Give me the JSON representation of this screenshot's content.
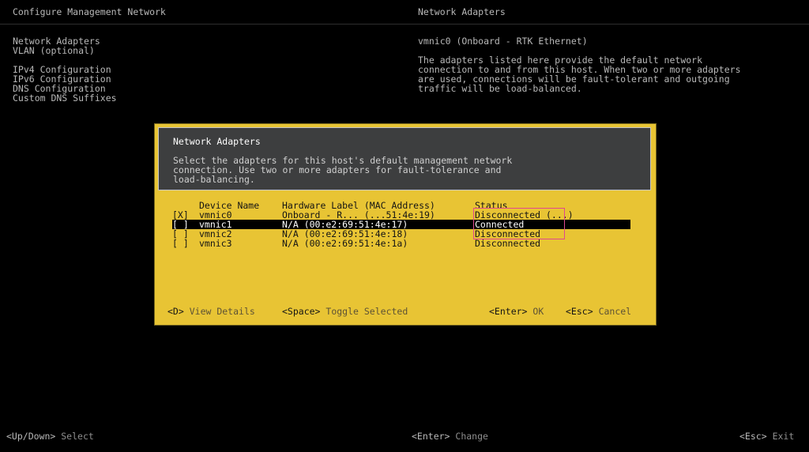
{
  "header": {
    "left_title": "Configure Management Network",
    "right_title": "Network Adapters"
  },
  "menu": {
    "items": [
      "Network Adapters",
      "VLAN (optional)",
      "IPv4 Configuration",
      "IPv6 Configuration",
      "DNS Configuration",
      "Custom DNS Suffixes"
    ]
  },
  "info": {
    "title": "vmnic0 (Onboard - RTK Ethernet)",
    "description": [
      "The adapters listed here provide the default network",
      "connection to and from this host. When two or more adapters",
      "are used, connections will be fault-tolerant and outgoing",
      "traffic will be load-balanced."
    ]
  },
  "dialog": {
    "title": "Network Adapters",
    "description": [
      "Select the adapters for this host's default management network",
      "connection. Use two or more adapters for fault-tolerance and",
      "load-balancing."
    ],
    "columns": {
      "name": "Device Name",
      "mac": "Hardware Label (MAC Address)",
      "status": "Status"
    },
    "rows": [
      {
        "sel": "[X]",
        "name": "vmnic0",
        "mac": "Onboard - R... (...51:4e:19)",
        "status": "Disconnected (...)"
      },
      {
        "sel": "[ ]",
        "name": "vmnic1",
        "mac": "N/A (00:e2:69:51:4e:17)",
        "status": "Connected"
      },
      {
        "sel": "[ ]",
        "name": "vmnic2",
        "mac": "N/A (00:e2:69:51:4e:18)",
        "status": "Disconnected"
      },
      {
        "sel": "[ ]",
        "name": "vmnic3",
        "mac": "N/A (00:e2:69:51:4e:1a)",
        "status": "Disconnected"
      }
    ],
    "selected_row": 1,
    "footer": {
      "details_key": "<D>",
      "details_label": "View Details",
      "toggle_key": "<Space>",
      "toggle_label": "Toggle Selected",
      "ok_key": "<Enter>",
      "ok_label": "OK",
      "cancel_key": "<Esc>",
      "cancel_label": "Cancel"
    }
  },
  "bottom_bar": {
    "select_key": "<Up/Down>",
    "select_label": "Select",
    "change_key": "<Enter>",
    "change_label": "Change",
    "exit_key": "<Esc>",
    "exit_label": "Exit"
  },
  "colors": {
    "background": "#000000",
    "dialog_body": "#e8c434",
    "dialog_header": "#3d3e3f",
    "highlight_box": "#e0488f"
  }
}
